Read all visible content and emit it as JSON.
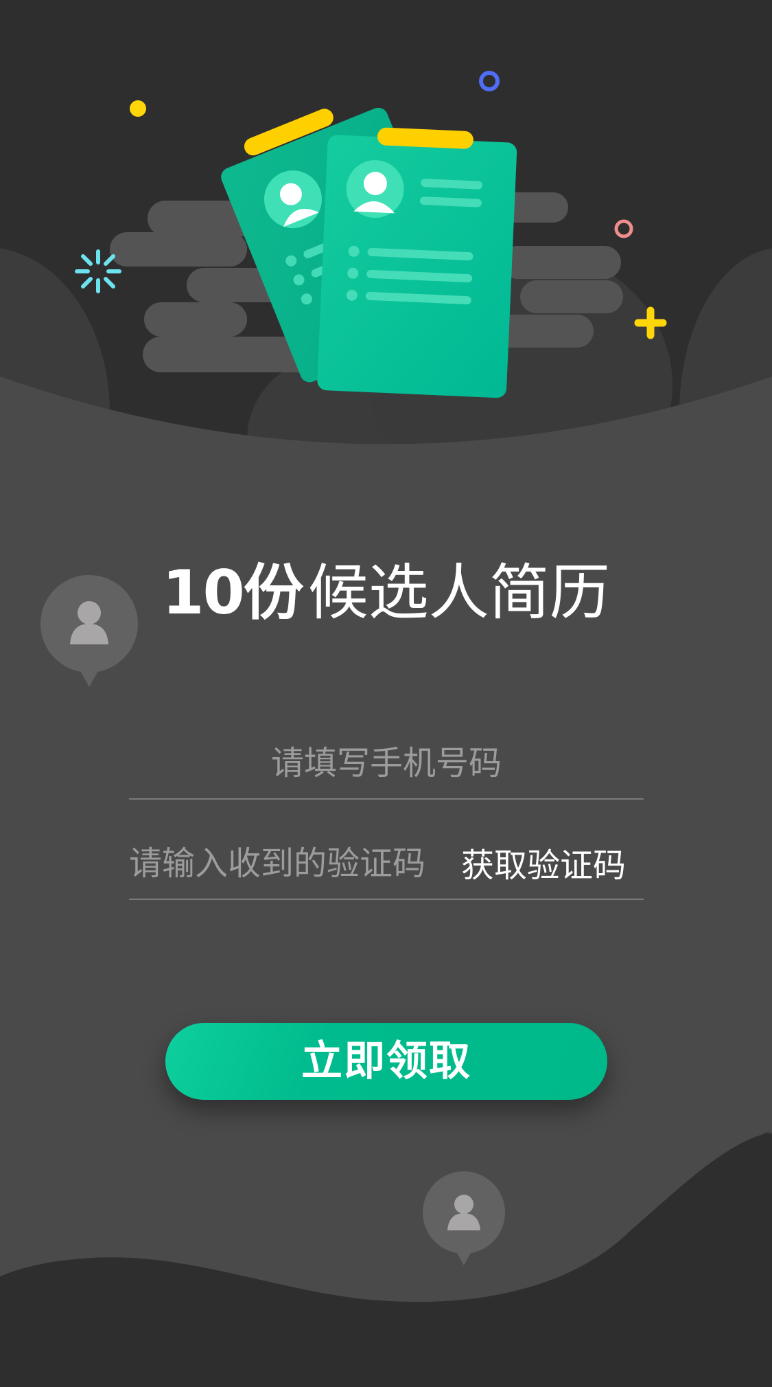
{
  "hero": {
    "title_number": "10份",
    "title_text": "候选人简历"
  },
  "form": {
    "phone_placeholder": "请填写手机号码",
    "code_placeholder": "请输入收到的验证码",
    "get_code_label": "获取验证码",
    "submit_label": "立即领取"
  },
  "colors": {
    "background": "#2e2e2e",
    "panel": "#4a4a4a",
    "accent_green": "#00b98a",
    "document_green": "#10c99b",
    "clip_yellow": "#ffd60a",
    "sparkle_cyan": "#6ee3f0",
    "ring_blue": "#4f6df5",
    "ring_pink": "#f08d8d"
  },
  "icons": {
    "resume_illustration": "resume-documents-icon",
    "profile_pin": "user-pin-icon",
    "sparkle": "sparkle-icon",
    "plus": "plus-icon"
  }
}
